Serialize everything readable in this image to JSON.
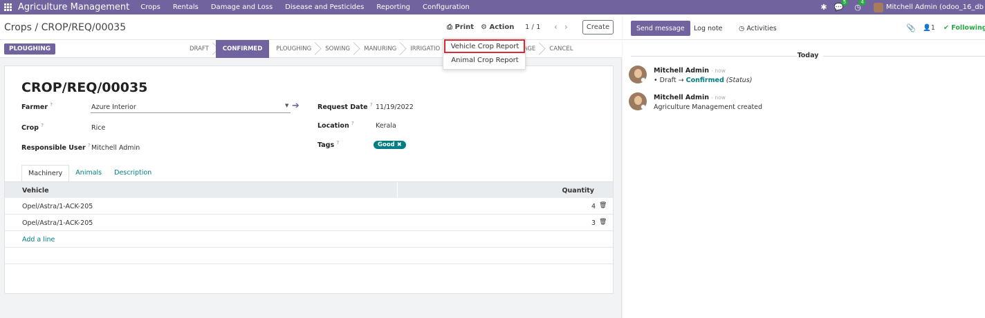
{
  "topbar": {
    "brand": "Agriculture Management",
    "menu": [
      "Crops",
      "Rentals",
      "Damage and Loss",
      "Disease and Pesticides",
      "Reporting",
      "Configuration"
    ],
    "messages_badge": "5",
    "activities_badge": "4",
    "user": "Mitchell Admin (odoo_16_db"
  },
  "control": {
    "breadcrumb": "Crops / CROP/REQ/00035",
    "print_label": "Print",
    "action_label": "Action",
    "pager": "1 / 1",
    "create_label": "Create"
  },
  "print_menu": {
    "items": [
      "Vehicle Crop Report",
      "Animal Crop Report"
    ]
  },
  "status": {
    "button_label": "PLOUGHING",
    "stages": [
      "DRAFT",
      "CONFIRMED",
      "PLOUGHING",
      "SOWING",
      "MANURING",
      "IRRIGATIO",
      "ST",
      "STORAGE",
      "CANCEL"
    ],
    "active_stage": "CONFIRMED"
  },
  "form": {
    "title": "CROP/REQ/00035",
    "farmer_label": "Farmer",
    "farmer_value": "Azure Interior",
    "crop_label": "Crop",
    "crop_value": "Rice",
    "user_label": "Responsible User",
    "user_value": "Mitchell Admin",
    "date_label": "Request Date",
    "date_value": "11/19/2022",
    "location_label": "Location",
    "location_value": "Kerala",
    "tags_label": "Tags",
    "tag_value": "Good",
    "help_mark": "?"
  },
  "tabs": [
    "Machinery",
    "Animals",
    "Description"
  ],
  "table": {
    "col_vehicle": "Vehicle",
    "col_quantity": "Quantity",
    "rows": [
      {
        "vehicle": "Opel/Astra/1-ACK-205",
        "quantity": "4"
      },
      {
        "vehicle": "Opel/Astra/1-ACK-205",
        "quantity": "3"
      }
    ],
    "add_line": "Add a line"
  },
  "chatter": {
    "send_message": "Send message",
    "log_note": "Log note",
    "activities": "Activities",
    "followers_count": "1",
    "following": "Following",
    "today": "Today",
    "messages": [
      {
        "author": "Mitchell Admin",
        "when": "- now",
        "bullet": "Draft",
        "arrow": "→",
        "new_value": "Confirmed",
        "field": "(Status)"
      },
      {
        "author": "Mitchell Admin",
        "when": "- now",
        "body": "Agriculture Management created"
      }
    ]
  },
  "colors": {
    "brand": "#71639e",
    "link": "#017e84",
    "highlight_box": "#e0282e",
    "following": "#28a745"
  }
}
